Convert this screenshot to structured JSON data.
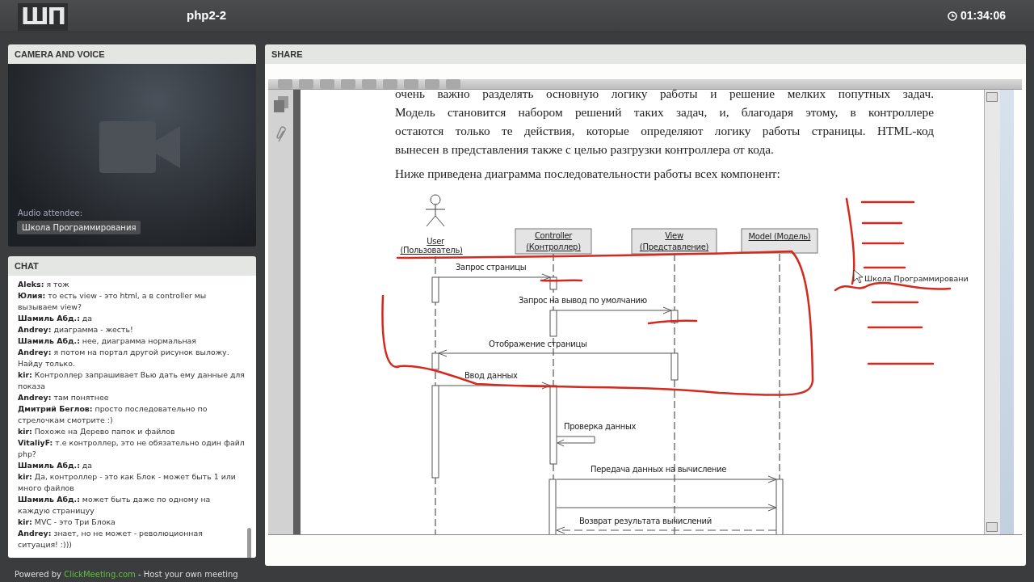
{
  "header": {
    "logo": "ШП",
    "title": "php2-2",
    "time": "01:34:06"
  },
  "camera": {
    "title": "CAMERA AND VOICE",
    "audio_label": "Audio attendee:",
    "attendee": "Школа Программирования"
  },
  "chat": {
    "title": "CHAT",
    "messages": [
      {
        "author": "Aleks:",
        "text": "я тож"
      },
      {
        "author": "Юлия:",
        "text": "то есть view - это html, а в controller мы вызываем view?"
      },
      {
        "author": "Шамиль Абд.:",
        "text": "да"
      },
      {
        "author": "Andrey:",
        "text": "диаграмма - жесть!"
      },
      {
        "author": "Шамиль Абд.:",
        "text": "нее, диаграмма нормальная"
      },
      {
        "author": "Andrey:",
        "text": "я потом на портал другой рисунок выложу. Найду только."
      },
      {
        "author": "kir:",
        "text": "Контроллер запрашивает Вью дать ему данные для показа"
      },
      {
        "author": "Andrey:",
        "text": "там понятнее"
      },
      {
        "author": "Дмитрий Беглов:",
        "text": "просто последовательно по стрелочкам смотрите :)"
      },
      {
        "author": "kir:",
        "text": "Похоже на Дерево папок и файлов"
      },
      {
        "author": "VitaliyF:",
        "text": "т.е контроллер, это не обязательно один файл php?"
      },
      {
        "author": "Шамиль Абд.:",
        "text": "да"
      },
      {
        "author": "kir:",
        "text": "Да, контроллер - это как Блок - может быть 1 или много файлов"
      },
      {
        "author": "Шамиль Абд.:",
        "text": "может быть даже по одному на каждую страницуу"
      },
      {
        "author": "kir:",
        "text": "MVC - это Три Блока"
      },
      {
        "author": "Andrey:",
        "text": "знает, но не может - революционная ситуация! :)))"
      }
    ]
  },
  "footer": {
    "prefix": "Powered by",
    "link": "ClickMeeting.com",
    "suffix": "- Host your own meeting"
  },
  "share": {
    "title": "SHARE",
    "document": {
      "paragraph_lines": [
        "очень важно разделять основную логику работы и решение мелких попутных задач.",
        "Модель становится набором решений таких задач, и, благодаря этому, в контроллере",
        "остаются только те действия, которые определяют логику работы страницы. HTML-код",
        "вынесен в представления также с целью разгрузки контроллера от кода."
      ],
      "intro": "Ниже приведена диаграмма последовательности работы всех компонент:",
      "diagram": {
        "participants": [
          {
            "kind": "actor",
            "name": "User",
            "subtitle": "(Пользователь)"
          },
          {
            "kind": "object",
            "name": "Controller",
            "subtitle": "(Контроллер)"
          },
          {
            "kind": "object",
            "name": "View",
            "subtitle": "(Представление)"
          },
          {
            "kind": "object",
            "name": "Model (Модель)"
          }
        ],
        "messages": [
          {
            "kind": "call",
            "label": "Запрос страницы"
          },
          {
            "kind": "call",
            "label": "Запрос  на вывод по умолчанию"
          },
          {
            "kind": "call",
            "label": "Отображение  страницы"
          },
          {
            "kind": "call",
            "label": "Ввод данных"
          },
          {
            "kind": "self",
            "label": "Проверка данных"
          },
          {
            "kind": "call",
            "label": "Передача данных  на вычисление"
          },
          {
            "kind": "call"
          },
          {
            "kind": "return",
            "label": "Возврат результата  вычислений"
          }
        ]
      }
    },
    "cursor_label": "Школа Программировани"
  }
}
